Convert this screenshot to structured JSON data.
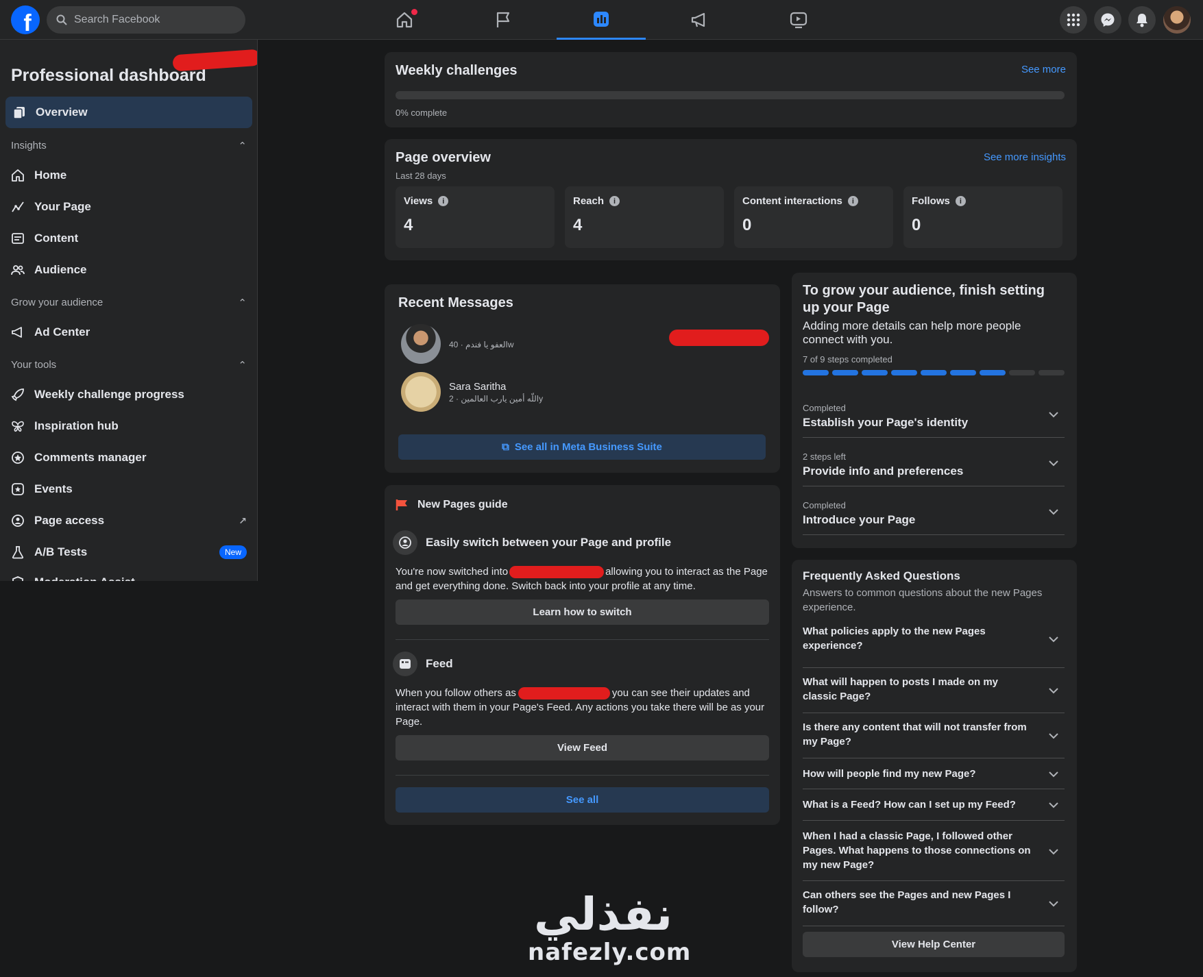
{
  "topbar": {
    "search_placeholder": "Search Facebook",
    "logo_letter": "f"
  },
  "sidebar": {
    "title": "Professional dashboard",
    "overview": "Overview",
    "sections": {
      "insights": "Insights",
      "grow": "Grow your audience",
      "tools": "Your tools"
    },
    "insights_items": [
      "Home",
      "Your Page",
      "Content",
      "Audience"
    ],
    "grow_items": [
      "Ad Center"
    ],
    "tools_items": [
      "Weekly challenge progress",
      "Inspiration hub",
      "Comments manager",
      "Events",
      "Page access",
      "A/B Tests",
      "Moderation Assist"
    ],
    "new_badge": "New"
  },
  "weekly": {
    "title": "Weekly challenges",
    "see_more": "See more",
    "progress_text": "0% complete",
    "progress_pct": 0
  },
  "overview": {
    "title": "Page overview",
    "subtitle": "Last 28 days",
    "see_more": "See more insights",
    "stats": [
      {
        "label": "Views",
        "value": "4"
      },
      {
        "label": "Reach",
        "value": "4"
      },
      {
        "label": "Content interactions",
        "value": "0"
      },
      {
        "label": "Follows",
        "value": "0"
      }
    ]
  },
  "messages": {
    "title": "Recent Messages",
    "items": [
      {
        "name": "",
        "snippet": "العفو يا فندم · 40w"
      },
      {
        "name": "Sara Saritha",
        "snippet": "اللّه أمين يارب العالمين · 2y"
      }
    ],
    "button": "See all in Meta Business Suite"
  },
  "guide": {
    "header": "New Pages guide",
    "switch_title": "Easily switch between your Page and profile",
    "switch_text_1": "You're now switched into",
    "switch_text_2": "allowing you to interact as the Page and get everything done. Switch back into your profile at any time.",
    "switch_button": "Learn how to switch",
    "feed_title": "Feed",
    "feed_text_1": "When you follow others as",
    "feed_text_2": "you can see their updates and interact with them in your Page's Feed. Any actions you take there will be as your Page.",
    "feed_button": "View Feed",
    "see_all": "See all"
  },
  "setup": {
    "title": "To grow your audience, finish setting up your Page",
    "subtitle": "Adding more details can help more people connect with you.",
    "steps_text": "7 of 9 steps completed",
    "steps_done": 7,
    "steps_total": 9,
    "items": [
      {
        "status": "Completed",
        "label": "Establish your Page's identity"
      },
      {
        "status": "2 steps left",
        "label": "Provide info and preferences"
      },
      {
        "status": "Completed",
        "label": "Introduce your Page"
      }
    ]
  },
  "faq": {
    "title": "Frequently Asked Questions",
    "subtitle": "Answers to common questions about the new Pages experience.",
    "questions": [
      "What policies apply to the new Pages experience?",
      "What will happen to posts I made on my classic Page?",
      "Is there any content that will not transfer from my Page?",
      "How will people find my new Page?",
      "What is a Feed? How can I set up my Feed?",
      "When I had a classic Page, I followed other Pages. What happens to those connections on my new Page?",
      "Can others see the Pages and new Pages I follow?"
    ],
    "button": "View Help Center"
  },
  "watermark": {
    "arabic": "نفذلي",
    "latin": "nafezly.com"
  },
  "colors": {
    "accent": "#2d88ff",
    "redaction": "#e11d1d",
    "card": "#242526",
    "background": "#18191a"
  },
  "icons": [
    "search-icon",
    "home-icon",
    "flag-icon",
    "dashboard-icon",
    "megaphone-icon",
    "video-icon",
    "grid-menu-icon",
    "messenger-icon",
    "bell-icon"
  ]
}
